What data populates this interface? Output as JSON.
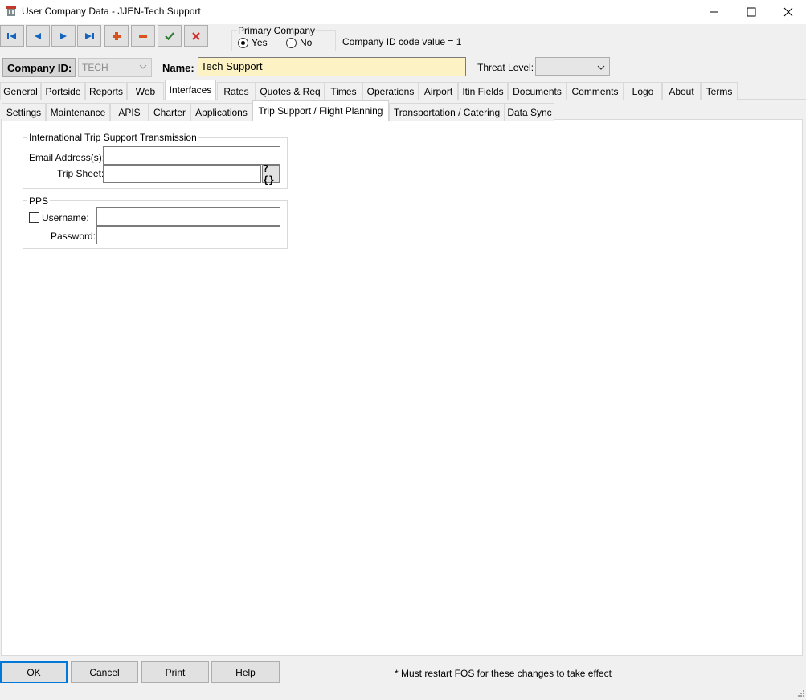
{
  "window": {
    "title": "User Company Data - JJEN-Tech Support"
  },
  "toolbar": {
    "buttons": [
      {
        "icon": "first-record-icon"
      },
      {
        "icon": "previous-record-icon"
      },
      {
        "icon": "next-record-icon"
      },
      {
        "icon": "last-record-icon"
      },
      {
        "icon": "add-record-icon"
      },
      {
        "icon": "delete-record-icon"
      },
      {
        "icon": "save-check-icon"
      },
      {
        "icon": "cancel-x-icon"
      }
    ],
    "colors": {
      "nav": "#1565c0",
      "add": "#d9531e",
      "save": "#2e7d32",
      "cancel": "#d32f2f"
    }
  },
  "primary_company": {
    "legend": "Primary Company",
    "yes_label": "Yes",
    "no_label": "No",
    "selected": "Yes"
  },
  "company_id_code": "Company ID code value = 1",
  "company": {
    "id_label": "Company ID:",
    "id_value": "TECH",
    "name_label": "Name:",
    "name_value": "Tech Support",
    "threat_label": "Threat Level:",
    "threat_value": ""
  },
  "tabs_main": [
    "General",
    "Portside",
    "Reports",
    "Web",
    "Interfaces",
    "Rates",
    "Quotes & Req",
    "Times",
    "Operations",
    "Airport",
    "Itin Fields",
    "Documents",
    "Comments",
    "Logo",
    "About",
    "Terms"
  ],
  "tabs_main_active": "Interfaces",
  "tabs_sub": [
    "Settings",
    "Maintenance",
    "APIS",
    "Charter",
    "Applications",
    "Trip Support / Flight Planning",
    "Transportation / Catering",
    "Data Sync"
  ],
  "tabs_sub_active": "Trip Support / Flight Planning",
  "intl_group": {
    "legend": "International Trip Support Transmission",
    "email_label": "Email Address(s):",
    "email_value": "",
    "tripsheet_label": "Trip Sheet:",
    "tripsheet_value": "",
    "tripsheet_button": "?{}"
  },
  "pps_group": {
    "legend": "PPS",
    "username_label": "Username:",
    "username_checked": false,
    "username_value": "",
    "password_label": "Password:",
    "password_value": ""
  },
  "bottom": {
    "ok": "OK",
    "cancel": "Cancel",
    "print": "Print",
    "help": "Help",
    "note": "* Must restart FOS for these changes to take effect"
  }
}
